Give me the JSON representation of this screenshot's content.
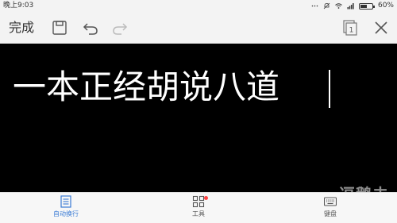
{
  "status": {
    "time": "晚上9:03",
    "battery_percent_text": "60%",
    "battery_level": 0.6
  },
  "toolbar": {
    "done_label": "完成",
    "icons": [
      "save-icon",
      "undo-icon",
      "redo-icon",
      "page-count-icon",
      "close-icon"
    ],
    "page_count": "1"
  },
  "editor": {
    "text": "一本正经胡说八道"
  },
  "bottom": {
    "items": [
      {
        "label": "自动换行",
        "icon": "wrap-icon",
        "active": true
      },
      {
        "label": "工具",
        "icon": "tools-icon",
        "active": false
      },
      {
        "label": "键盘",
        "icon": "keyboard-icon",
        "active": false
      }
    ],
    "accent": "#3a7bd5"
  },
  "watermark": "逗鹅去"
}
